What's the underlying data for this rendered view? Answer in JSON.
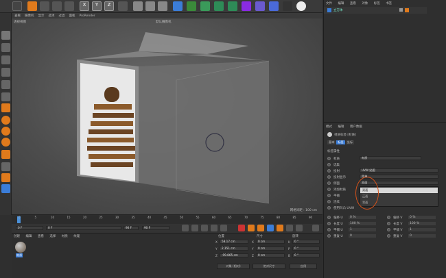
{
  "top_menu": {
    "items": [
      "查看",
      "摄像机",
      "显示",
      "选项",
      "过滤",
      "面板",
      "ProRender"
    ]
  },
  "viewport": {
    "name": "透视视图",
    "camera": "默认摄像机",
    "grid_distance": "网格间距 : 100 cm"
  },
  "timeline": {
    "ticks": [
      "0",
      "5",
      "10",
      "15",
      "20",
      "25",
      "30",
      "35",
      "40",
      "45",
      "50",
      "55",
      "60",
      "65",
      "70",
      "75",
      "80",
      "85",
      "90"
    ],
    "current_frame": "0 F"
  },
  "transport": {
    "start": "0 F",
    "current": "0 F",
    "end": "90 F",
    "end2": "90 F"
  },
  "material_panel": {
    "menu": [
      "创建",
      "编辑",
      "查看",
      "选择",
      "材质",
      "纹理"
    ],
    "material_name": "材质"
  },
  "coords": {
    "headers": [
      "位置",
      "尺寸",
      "旋转"
    ],
    "rows": [
      {
        "axis": "X",
        "pos": "58.17 cm",
        "size_axis": "X",
        "size": "0 cm",
        "rot_axis": "H",
        "rot": "0 °"
      },
      {
        "axis": "Y",
        "pos": "2.151 cm",
        "size_axis": "Y",
        "size": "0 cm",
        "rot_axis": "P",
        "rot": "0 °"
      },
      {
        "axis": "Z",
        "pos": "-99.865 cm",
        "size_axis": "Z",
        "size": "0 cm",
        "rot_axis": "B",
        "rot": "0 °"
      }
    ],
    "mode": "对象 (相对)",
    "size_mode": "绝对尺寸",
    "apply": "应用"
  },
  "object_manager": {
    "menu": [
      "文件",
      "编辑",
      "查看",
      "对象",
      "标签",
      "书签"
    ],
    "object": "立方体"
  },
  "attr_manager": {
    "menu": [
      "模式",
      "编辑",
      "用户数据"
    ],
    "title": "材质标签 [材质]",
    "tabs": [
      "基本",
      "标签",
      "坐标"
    ],
    "section": "标签属性",
    "fields": [
      {
        "label": "材质",
        "value": "材质"
      },
      {
        "label": "选集",
        "value": ""
      },
      {
        "label": "投射",
        "value": "UVW 贴图"
      },
      {
        "label": "投射显示",
        "value": "简单"
      },
      {
        "label": "侧面",
        "value": "双面"
      },
      {
        "label": "添加材质",
        "value": ""
      },
      {
        "label": "平铺",
        "value": ""
      },
      {
        "label": "连续",
        "value": ""
      },
      {
        "label": "使用凹凸 UVW",
        "value": ""
      }
    ],
    "dropdown": [
      "双面",
      "正面",
      "背面"
    ],
    "uv_rows": [
      {
        "l1": "偏移 U",
        "v1": "0 %",
        "l2": "偏移 V",
        "v2": "0 %"
      },
      {
        "l1": "长度 U",
        "v1": "100 %",
        "l2": "长度 V",
        "v2": "100 %"
      },
      {
        "l1": "平铺 U",
        "v1": "1",
        "l2": "平铺 V",
        "v2": "1"
      },
      {
        "l1": "重复 U",
        "v1": "0",
        "l2": "重复 V",
        "v2": "0"
      }
    ]
  }
}
